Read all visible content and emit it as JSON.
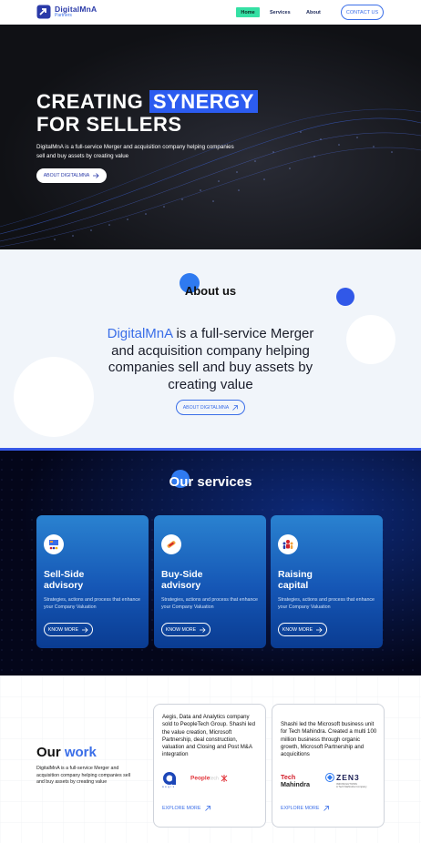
{
  "nav": {
    "logo_name": "DigitalMnA",
    "logo_sub": "Partners",
    "items": [
      "Home",
      "Services",
      "About"
    ],
    "contact": "CONTACT US",
    "accent": "#35e0a4"
  },
  "hero": {
    "title_1": "CREATING ",
    "title_highlight": "SYNERGY",
    "title_2": "FOR SELLERS",
    "description": "DigitalMnA is a full-service Merger and acquisition company helping companies sell and buy assets by creating value",
    "button": "ABOUT DIGITALMNA",
    "button_icon": "arrow-right-icon"
  },
  "about": {
    "title": "About us",
    "brand": "DigitalMnA",
    "text": " is a full-service Merger and acquisition company helping companies sell and buy assets by creating value",
    "button": "ABOUT DIGITALMNA",
    "button_icon": "arrow-up-right-icon",
    "accent": "#3a6ee8"
  },
  "services": {
    "title": "Our services",
    "cards": [
      {
        "title_1": "Sell-Side",
        "title_2": "advisory",
        "description": "Strategies, actions and process that enhance your Company Valuation",
        "button": "KNOW MORE",
        "icon": "presentation-icon"
      },
      {
        "title_1": "Buy-Side",
        "title_2": "advisory",
        "description": "Strategies, actions and process that enhance your Company Valuation",
        "button": "KNOW MORE",
        "icon": "handshake-icon"
      },
      {
        "title_1": "Raising",
        "title_2": "capital",
        "description": "Strategies, actions and process that enhance your Company Valuation",
        "button": "KNOW MORE",
        "icon": "team-icon"
      }
    ]
  },
  "work": {
    "title_1": "Our ",
    "title_2": "work",
    "description": "DigitalMnA is a full-service Merger and acquisition company helping companies sell and buy assets by creating value",
    "cards": [
      {
        "text": "Aegis, Data and Analytics company sold to PeopleTech Group. Shashi led the value creation, Microsoft Partnership, deal construction, valuation and Closing and Post M&A integration",
        "logo_1": "aegis",
        "logo_2": "People",
        "logo_2b": "tech",
        "link": "EXPLORE MORE"
      },
      {
        "text": "Shashi led the Microsoft business unit for Tech Mahindra. Created a multi 100 million business through organic growth, Microsoft Partnership and acquicitions",
        "logo_1a": "Tech",
        "logo_1b": "Mahindra",
        "logo_2": "ZEN3",
        "logo_2_sub_1": "INFOSOLUTIONS",
        "logo_2_sub_2": "A Tech Mahindra Company",
        "link": "EXPLORE MORE"
      }
    ]
  }
}
